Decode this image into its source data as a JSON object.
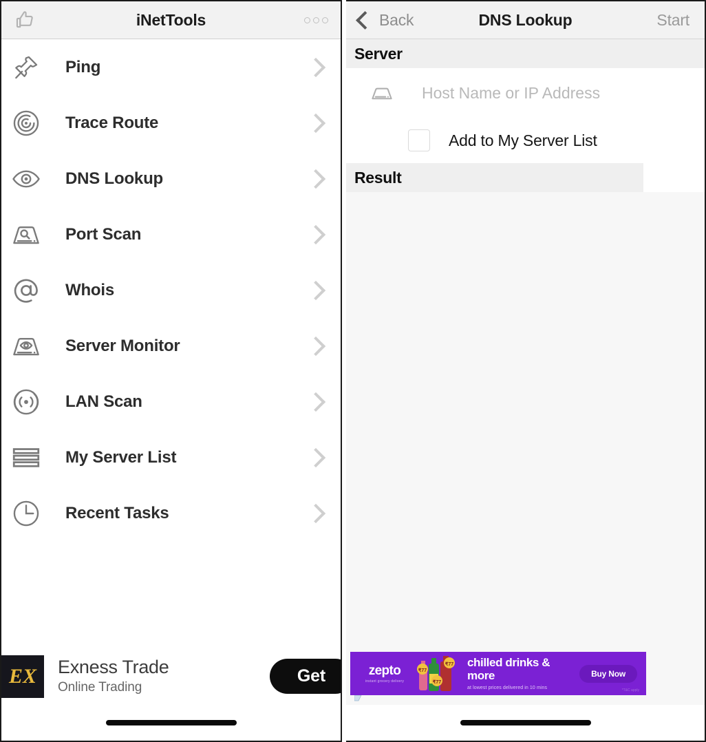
{
  "left_screen": {
    "nav": {
      "title": "iNetTools",
      "like_icon": "thumbs-up-icon",
      "more_icon": "more-options-icon"
    },
    "menu_items": [
      {
        "label": "Ping",
        "icon": "pushpin-icon"
      },
      {
        "label": "Trace Route",
        "icon": "radar-target-icon"
      },
      {
        "label": "DNS Lookup",
        "icon": "eye-icon"
      },
      {
        "label": "Port Scan",
        "icon": "server-search-icon"
      },
      {
        "label": "Whois",
        "icon": "at-sign-icon"
      },
      {
        "label": "Server Monitor",
        "icon": "server-eye-icon"
      },
      {
        "label": "LAN Scan",
        "icon": "broadcast-icon"
      },
      {
        "label": "My Server List",
        "icon": "list-lines-icon"
      },
      {
        "label": "Recent Tasks",
        "icon": "clock-icon"
      }
    ],
    "ad": {
      "logo_text": "EX",
      "title": "Exness Trade",
      "subtitle": "Online Trading",
      "cta": "Get"
    }
  },
  "right_screen": {
    "nav": {
      "back_label": "Back",
      "title": "DNS Lookup",
      "start_label": "Start",
      "back_icon": "chevron-left-icon"
    },
    "server_section": {
      "header": "Server",
      "host_placeholder": "Host Name or IP Address",
      "host_value": "",
      "host_icon": "server-icon",
      "checkbox_label": "Add to My Server List",
      "checkbox_checked": false
    },
    "result_section": {
      "header": "Result",
      "content": ""
    },
    "banner": {
      "brand": "zepto",
      "brand_tagline": "instant grocery delivery",
      "headline": "chilled drinks & more",
      "subline": "at lowest prices delivered in 10 mins",
      "cta": "Buy Now",
      "fine_print": "*T&C apply",
      "bg_color": "#7b21d4",
      "cta_color": "#6b19bd"
    }
  },
  "colors": {
    "nav_bg": "#f2f2f2",
    "section_bg": "#efefef",
    "result_bg": "#f7f7f7",
    "text_primary": "#1c1c1c",
    "text_muted": "#9a9a9a",
    "chevron": "#cfcfcf",
    "accent_purple": "#7b21d4"
  }
}
